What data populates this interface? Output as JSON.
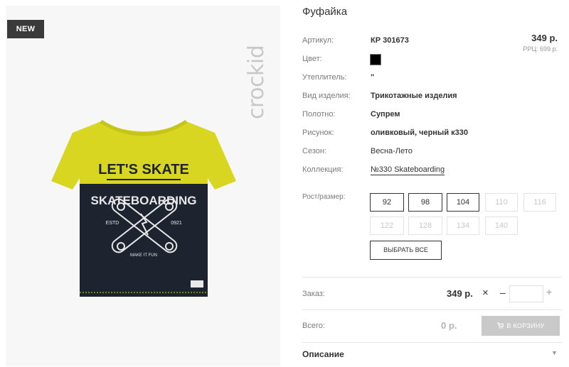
{
  "product": {
    "badge": "NEW",
    "brand": "crockid",
    "title": "Фуфайка",
    "price": "349 р.",
    "rrp": "РРЦ: 699 р.",
    "print_text_1": "LET'S SKATE",
    "print_text_2": "SKATEBOARDING",
    "print_text_3": "ESTD",
    "print_text_4": "0921",
    "print_text_5": "MAKE IT FUN"
  },
  "attributes": [
    {
      "label": "Артикул:",
      "value": "КР 301673"
    },
    {
      "label": "Цвет:",
      "value": ""
    },
    {
      "label": "Утеплитель:",
      "value": "\""
    },
    {
      "label": "Вид изделия:",
      "value": "Трикотажные изделия"
    },
    {
      "label": "Полотно:",
      "value": "Супрем"
    },
    {
      "label": "Рисунок:",
      "value": "оливковый, черный к330"
    },
    {
      "label": "Сезон:",
      "value": "Весна-Лето"
    },
    {
      "label": "Коллекция:",
      "value": "№330 Skateboarding"
    }
  ],
  "swatch_color": "#000000",
  "sizes": {
    "label": "Рост/размер:",
    "items": [
      {
        "label": "92",
        "available": true
      },
      {
        "label": "98",
        "available": true
      },
      {
        "label": "104",
        "available": true
      },
      {
        "label": "110",
        "available": false
      },
      {
        "label": "116",
        "available": false
      },
      {
        "label": "122",
        "available": false
      },
      {
        "label": "128",
        "available": false
      },
      {
        "label": "134",
        "available": false
      },
      {
        "label": "140",
        "available": false
      }
    ],
    "select_all": "ВЫБРАТЬ ВСЕ"
  },
  "order": {
    "label": "Заказ:",
    "price": "349 р.",
    "remove": "×",
    "minus": "–",
    "plus": "+",
    "quantity": ""
  },
  "total": {
    "label": "Всего:",
    "value": "0 р.",
    "cart_button": "В КОРЗИНУ"
  },
  "description": {
    "label": "Описание"
  },
  "colors": {
    "shirt_yellow": "#d8d620",
    "shirt_navy": "#1d2430",
    "cart_disabled": "#c9c9c9"
  }
}
